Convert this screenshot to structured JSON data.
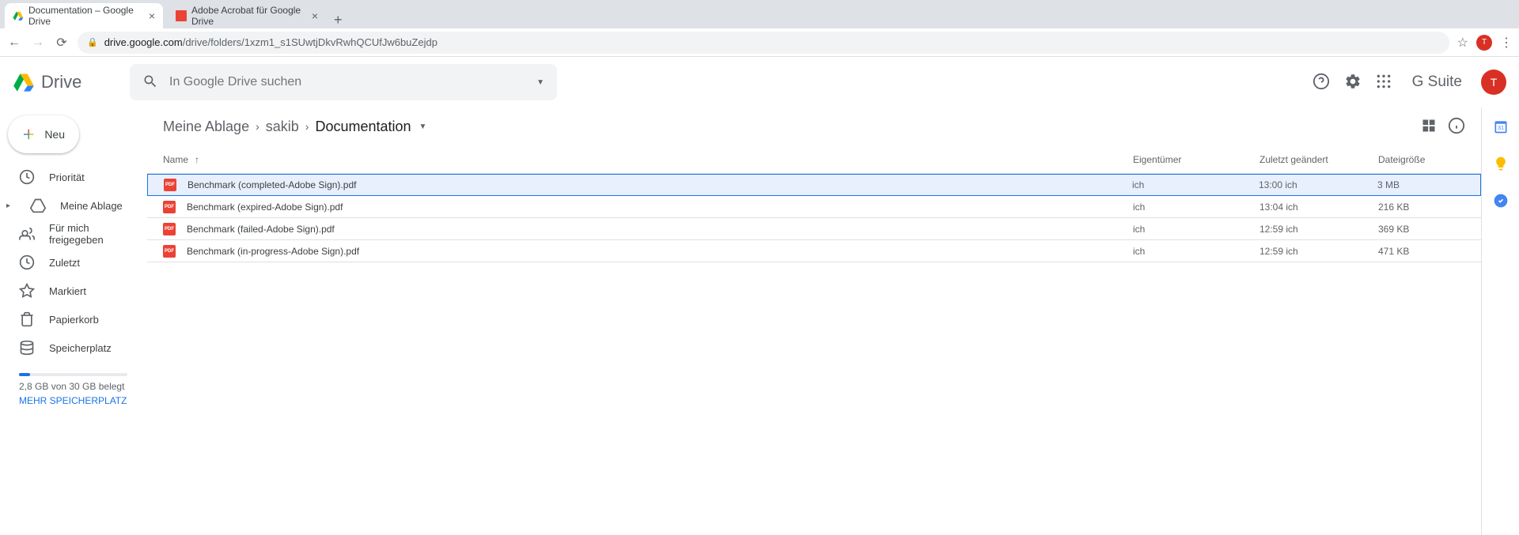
{
  "browser": {
    "tabs": [
      {
        "title": "Documentation – Google Drive",
        "favicon": "drive"
      },
      {
        "title": "Adobe Acrobat für Google Drive",
        "favicon": "pdf"
      }
    ],
    "url_host": "drive.google.com",
    "url_path": "/drive/folders/1xzm1_s1SUwtjDkvRwhQCUfJw6buZejdp",
    "profile_initial": "T"
  },
  "header": {
    "app_name": "Drive",
    "search_placeholder": "In Google Drive suchen",
    "gsuite": "G Suite",
    "avatar_initial": "T"
  },
  "sidebar": {
    "new_label": "Neu",
    "items": [
      {
        "label": "Priorität",
        "icon": "priority"
      },
      {
        "label": "Meine Ablage",
        "icon": "mydrive",
        "expandable": true
      },
      {
        "label": "Für mich freigegeben",
        "icon": "shared"
      },
      {
        "label": "Zuletzt",
        "icon": "recent"
      },
      {
        "label": "Markiert",
        "icon": "starred"
      },
      {
        "label": "Papierkorb",
        "icon": "trash"
      }
    ],
    "storage_label": "Speicherplatz",
    "storage_text": "2,8 GB von 30 GB belegt",
    "storage_link": "MEHR SPEICHERPLATZ"
  },
  "breadcrumb": {
    "items": [
      "Meine Ablage",
      "sakib",
      "Documentation"
    ]
  },
  "columns": {
    "name": "Name",
    "owner": "Eigentümer",
    "modified": "Zuletzt geändert",
    "size": "Dateigröße"
  },
  "files": [
    {
      "name": "Benchmark (completed-Adobe Sign).pdf",
      "owner": "ich",
      "modified": "13:00 ich",
      "size": "3 MB",
      "selected": true
    },
    {
      "name": "Benchmark (expired-Adobe Sign).pdf",
      "owner": "ich",
      "modified": "13:04 ich",
      "size": "216 KB",
      "selected": false
    },
    {
      "name": "Benchmark (failed-Adobe Sign).pdf",
      "owner": "ich",
      "modified": "12:59 ich",
      "size": "369 KB",
      "selected": false
    },
    {
      "name": "Benchmark (in-progress-Adobe Sign).pdf",
      "owner": "ich",
      "modified": "12:59 ich",
      "size": "471 KB",
      "selected": false
    }
  ]
}
